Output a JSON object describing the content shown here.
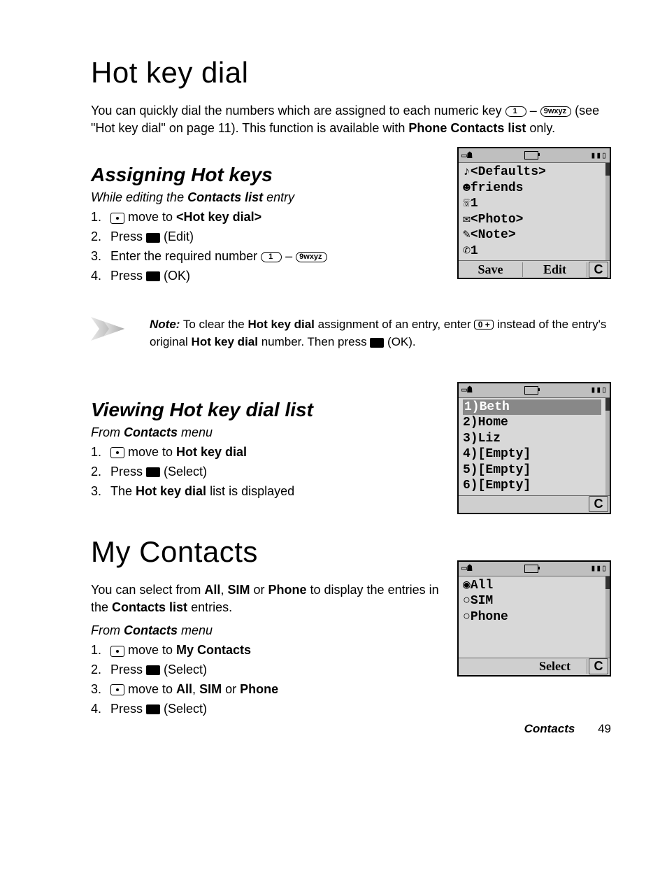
{
  "headings": {
    "h1a": "Hot key dial",
    "sub1": "Assigning Hot keys",
    "sub2": "Viewing Hot key dial list",
    "h1b": "My Contacts"
  },
  "intro": {
    "part1": "You can quickly dial the numbers which are assigned to each numeric key ",
    "part2": " – ",
    "part3": " (see \"Hot key dial\" on page 11). This function is available with ",
    "bold1": "Phone Contacts list",
    "part4": " only."
  },
  "assign": {
    "lead_pre": "While editing the ",
    "lead_bold": "Contacts list",
    "lead_post": " entry",
    "s1_pre": " move to ",
    "s1_bold": "<Hot key dial>",
    "s2_pre": "Press ",
    "s2_post": " (Edit)",
    "s3_pre": "Enter the required number ",
    "s3_mid": " – ",
    "s4_pre": "Press ",
    "s4_post": " (OK)"
  },
  "note": {
    "label": "Note:",
    "t1": " To clear the ",
    "b1": "Hot key dial",
    "t2": " assignment of an entry, enter ",
    "t3": " instead of the entry's original ",
    "b2": "Hot key dial",
    "t4": " number. Then press ",
    "t5": " (OK)."
  },
  "view": {
    "lead_pre": "From ",
    "lead_bold": "Contacts",
    "lead_post": " menu",
    "s1_pre": " move to ",
    "s1_bold": "Hot key dial",
    "s2_pre": "Press ",
    "s2_post": " (Select)",
    "s3_pre": "The ",
    "s3_bold": "Hot key dial",
    "s3_post": " list is displayed"
  },
  "mycontacts": {
    "p_pre": "You can select from ",
    "p_b1": "All",
    "p_sep": ", ",
    "p_b2": "SIM",
    "p_or": " or ",
    "p_b3": "Phone",
    "p_mid": " to display the entries in the ",
    "p_b4": "Contacts list",
    "p_post": " entries.",
    "lead_pre": "From ",
    "lead_bold": "Contacts",
    "lead_post": " menu",
    "s1_pre": " move to ",
    "s1_bold": "My Contacts",
    "s2_pre": "Press ",
    "s2_post": " (Select)",
    "s3_pre": " move to ",
    "s3_bold": "All",
    "s3_sep": ", ",
    "s3_bold2": "SIM",
    "s3_or": " or ",
    "s3_bold3": "Phone",
    "s4_pre": "Press ",
    "s4_post": " (Select)"
  },
  "phone1": {
    "l1": "<Defaults>",
    "l2": "friends",
    "l3": "1",
    "l4": "<Photo>",
    "l5": "<Note>",
    "l6": "1",
    "sk_left": "Save",
    "sk_mid": "Edit",
    "sk_right": "C"
  },
  "phone2": {
    "l1": "1)Beth",
    "l2": "2)Home",
    "l3": "3)Liz",
    "l4": "4)[Empty]",
    "l5": "5)[Empty]",
    "l6": "6)[Empty]",
    "sk_right": "C"
  },
  "phone3": {
    "l1": "All",
    "l2": "SIM",
    "l3": "Phone",
    "sk_mid": "Select",
    "sk_right": "C"
  },
  "keys": {
    "one": "1",
    "nine": "9wxyz",
    "zero": "0 +"
  },
  "footer": {
    "section": "Contacts",
    "page": "49"
  }
}
